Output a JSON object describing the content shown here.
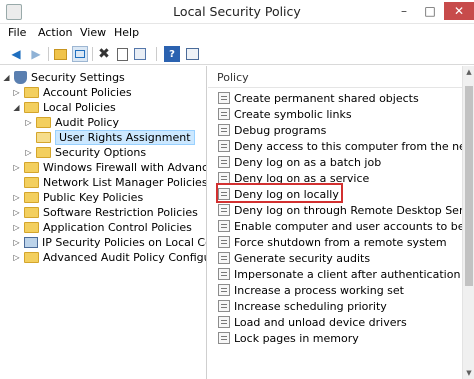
{
  "window": {
    "title": "Local Security Policy",
    "minimize": "–",
    "maximize": "□",
    "close": "✕"
  },
  "menu": [
    "File",
    "Action",
    "View",
    "Help"
  ],
  "toolbar": {
    "back": "◀",
    "forward": "▶",
    "delete": "✖",
    "help": "?"
  },
  "tree": {
    "root": "Security Settings",
    "items": [
      {
        "label": "Account Policies"
      },
      {
        "label": "Local Policies"
      },
      {
        "label": "Audit Policy"
      },
      {
        "label": "User Rights Assignment"
      },
      {
        "label": "Security Options"
      },
      {
        "label": "Windows Firewall with Advanced Secu"
      },
      {
        "label": "Network List Manager Policies"
      },
      {
        "label": "Public Key Policies"
      },
      {
        "label": "Software Restriction Policies"
      },
      {
        "label": "Application Control Policies"
      },
      {
        "label": "IP Security Policies on Local Compute"
      },
      {
        "label": "Advanced Audit Policy Configuration"
      }
    ]
  },
  "list": {
    "header": "Policy",
    "rows": [
      "Create permanent shared objects",
      "Create symbolic links",
      "Debug programs",
      "Deny access to this computer from the network",
      "Deny log on as a batch job",
      "Deny log on as a service",
      "Deny log on locally",
      "Deny log on through Remote Desktop Services",
      "Enable computer and user accounts to be trusted f",
      "Force shutdown from a remote system",
      "Generate security audits",
      "Impersonate a client after authentication",
      "Increase a process working set",
      "Increase scheduling priority",
      "Load and unload device drivers",
      "Lock pages in memory"
    ],
    "highlighted": "Deny log on locally"
  }
}
